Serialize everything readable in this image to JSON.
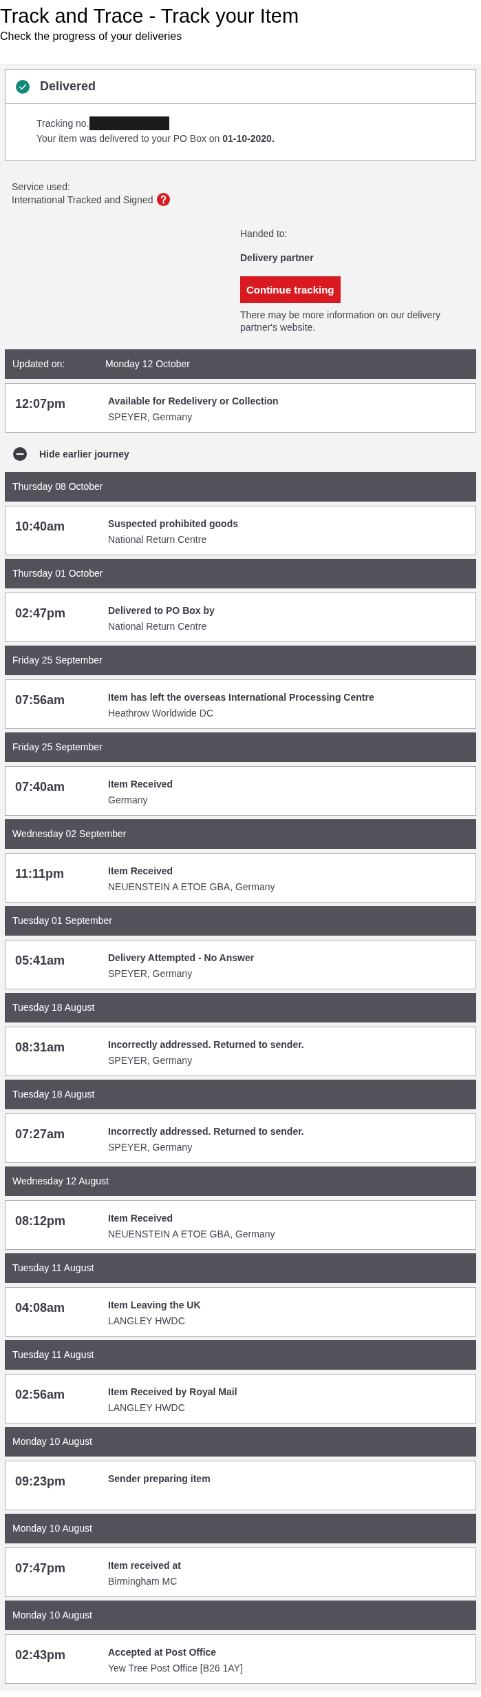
{
  "page": {
    "title": "Track and Trace - Track your Item",
    "subtitle": "Check the progress of your deliveries"
  },
  "status": {
    "label": "Delivered",
    "tracking_label": "Tracking no.",
    "message": "Your item was delivered to your PO Box on **01-10-2020.**"
  },
  "service": {
    "label": "Service used:",
    "name": "International Tracked and Signed"
  },
  "handover": {
    "label": "Handed to:",
    "partner": "Delivery partner",
    "button": "Continue tracking",
    "note": "There may be more information on our delivery partner's website."
  },
  "latest": {
    "updated_label": "Updated on:",
    "date": "Monday 12 October",
    "time": "12:07pm",
    "title": "Available for Redelivery or Collection",
    "location": "SPEYER, Germany"
  },
  "journey_toggle": {
    "label": "Hide earlier journey",
    "expanded": true
  },
  "events": [
    {
      "date": "Thursday 08 October",
      "time": "10:40am",
      "title": "Suspected prohibited goods",
      "location": "National Return Centre"
    },
    {
      "date": "Thursday 01 October",
      "time": "02:47pm",
      "title": "Delivered to PO Box by",
      "location": "National Return Centre"
    },
    {
      "date": "Friday 25 September",
      "time": "07:56am",
      "title": "Item has left the overseas International Processing Centre",
      "location": "Heathrow Worldwide DC"
    },
    {
      "date": "Friday 25 September",
      "time": "07:40am",
      "title": "Item Received",
      "location": "Germany"
    },
    {
      "date": "Wednesday 02 September",
      "time": "11:11pm",
      "title": "Item Received",
      "location": "NEUENSTEIN A ETOE GBA, Germany"
    },
    {
      "date": "Tuesday 01 September",
      "time": "05:41am",
      "title": "Delivery Attempted - No Answer",
      "location": "SPEYER, Germany"
    },
    {
      "date": "Tuesday 18 August",
      "time": "08:31am",
      "title": "Incorrectly addressed. Returned to sender.",
      "location": "SPEYER, Germany"
    },
    {
      "date": "Tuesday 18 August",
      "time": "07:27am",
      "title": "Incorrectly addressed. Returned to sender.",
      "location": "SPEYER, Germany"
    },
    {
      "date": "Wednesday 12 August",
      "time": "08:12pm",
      "title": "Item Received",
      "location": "NEUENSTEIN A ETOE GBA, Germany"
    },
    {
      "date": "Tuesday 11 August",
      "time": "04:08am",
      "title": "Item Leaving the UK",
      "location": "LANGLEY HWDC"
    },
    {
      "date": "Tuesday 11 August",
      "time": "02:56am",
      "title": "Item Received by Royal Mail",
      "location": "LANGLEY HWDC"
    },
    {
      "date": "Monday 10 August",
      "time": "09:23pm",
      "title": "Sender preparing item"
    },
    {
      "date": "Monday 10 August",
      "time": "07:47pm",
      "title": "Item received at",
      "location": "Birmingham MC"
    },
    {
      "date": "Monday 10 August",
      "time": "02:43pm",
      "title": "Accepted at Post Office",
      "location": "Yew Tree Post Office [B26 1AY]"
    }
  ]
}
